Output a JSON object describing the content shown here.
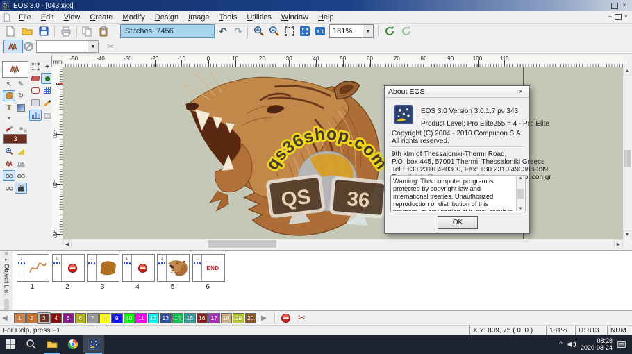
{
  "window": {
    "title": "EOS 3.0 - [043.xxx]"
  },
  "menu": {
    "items": [
      "File",
      "Edit",
      "View",
      "Create",
      "Modify",
      "Design",
      "Image",
      "Tools",
      "Utilities",
      "Window",
      "Help"
    ]
  },
  "toolbar": {
    "stitches_label": "Stitches: 7456",
    "zoom_value": "181%"
  },
  "rulers": {
    "unit": "mm",
    "h_ticks": [
      -50,
      -40,
      -30,
      -20,
      -10,
      0,
      10,
      20,
      30,
      40,
      50,
      60,
      70,
      80,
      90,
      100,
      110
    ],
    "v_ticks": [
      0,
      -20,
      -40,
      -60
    ]
  },
  "icons": {
    "undo": "↶",
    "redo": "↷",
    "scissors": "✂",
    "close": "×",
    "minimize": "–",
    "left_arrow": "◀",
    "right_arrow": "▶",
    "up_arrow": "▲",
    "down_arrow": "▼",
    "tray_chevron": "^",
    "needle_down": "↓",
    "combo_down": "▼"
  },
  "watermark": {
    "arc_text": "qs36shop.com",
    "screen_left": "QS",
    "screen_right": "36"
  },
  "about_dialog": {
    "title": "About EOS",
    "version_line": "EOS 3.0 Version 3.0.1.7 pv 343",
    "product_line": "Product Level:  Pro Elite255 =  4  - Pro Elite",
    "copyright_line1": "Copyright (C) 2004 - 2010 Compucon S.A.",
    "copyright_line2": "All rights reserved.",
    "address_line1": "9th klm of Thessaloniki-Thermi Road,",
    "address_line2": "P.O. box 445, 57001 Thermi, Thessaloniki Greece",
    "address_line3": "Tel.: +30 2310 490300, Fax: +30 2310 490388-399",
    "address_line4": "E-mail: info@compucon.gr,  http://www.compucon.gr",
    "warning_text": "Warning: This computer program is protected by copyright law and international treaties. Unauthorized reproduction or distribution of this program, or any portion of it, may result in severe",
    "ok_label": "OK"
  },
  "object_list": {
    "panel_title": "Object List",
    "items": [
      {
        "index": "1",
        "kind": "running-stitch-outline"
      },
      {
        "index": "2",
        "kind": "stop"
      },
      {
        "index": "3",
        "kind": "fill-area"
      },
      {
        "index": "4",
        "kind": "stop"
      },
      {
        "index": "5",
        "kind": "detail-stitches"
      },
      {
        "index": "6",
        "kind": "end",
        "label": "END"
      }
    ]
  },
  "palette": {
    "selected": "3",
    "colors": [
      {
        "num": "1",
        "hex": "#D0854A"
      },
      {
        "num": "2",
        "hex": "#C8732E"
      },
      {
        "num": "3",
        "hex": "#6E2F23"
      },
      {
        "num": "4",
        "hex": "#8C1212"
      },
      {
        "num": "5",
        "hex": "#8B1F8B"
      },
      {
        "num": "6",
        "hex": "#B8B81E"
      },
      {
        "num": "7",
        "hex": "#9A9A9A"
      },
      {
        "num": "8",
        "hex": "#FFFF00"
      },
      {
        "num": "9",
        "hex": "#1414FF"
      },
      {
        "num": "10",
        "hex": "#00FF00"
      },
      {
        "num": "11",
        "hex": "#FF00FF"
      },
      {
        "num": "12",
        "hex": "#00FFFF"
      },
      {
        "num": "13",
        "hex": "#2F4F9F"
      },
      {
        "num": "14",
        "hex": "#00C850"
      },
      {
        "num": "15",
        "hex": "#3AA0A0"
      },
      {
        "num": "16",
        "hex": "#8B2424"
      },
      {
        "num": "17",
        "hex": "#B030C0"
      },
      {
        "num": "18",
        "hex": "#D2B48C"
      },
      {
        "num": "19",
        "hex": "#B6C832"
      },
      {
        "num": "20",
        "hex": "#8B5A2B"
      }
    ]
  },
  "status_bar": {
    "help_text": "For Help, press F1",
    "xy_text": "X,Y: 809, 75  ( 0, 0 )",
    "zoom_text": "181%",
    "d_text": "D: 813",
    "num_text": "NUM"
  },
  "taskbar": {
    "time": "08:28",
    "date": "2020-08-24"
  }
}
